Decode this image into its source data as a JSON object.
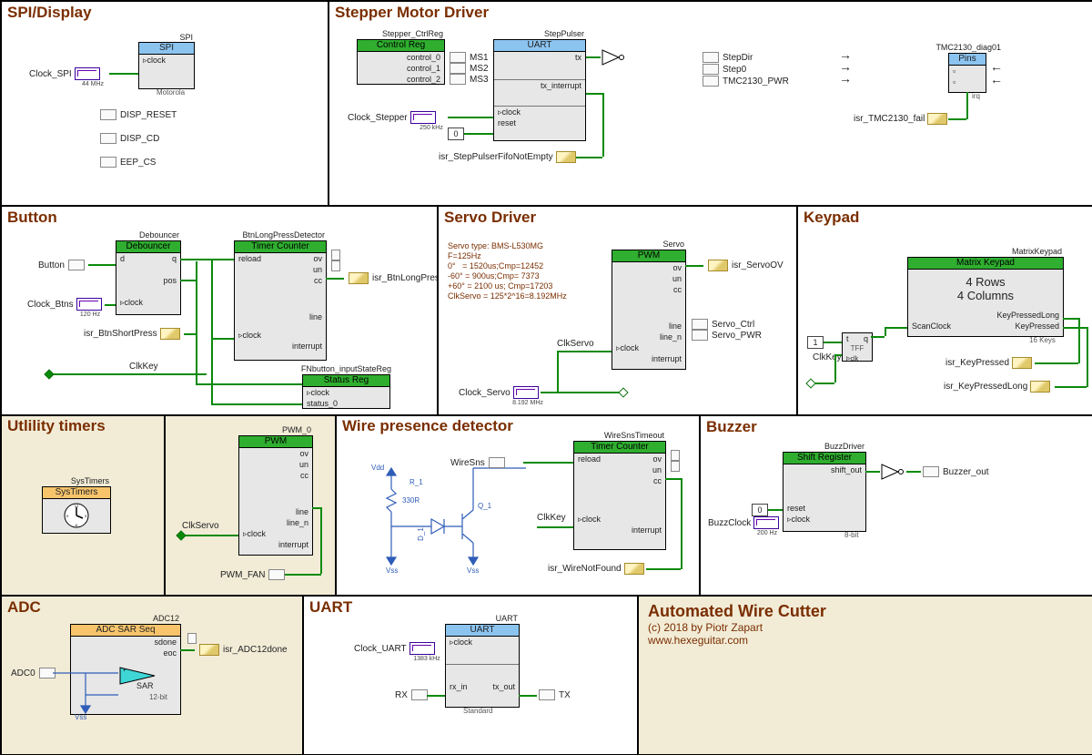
{
  "panels": {
    "spi": "SPI/Display",
    "stepper": "Stepper Motor Driver",
    "button": "Button",
    "servo": "Servo Driver",
    "keypad": "Keypad",
    "util": "Utlility timers",
    "wpd": "Wire presence detector",
    "buzzer": "Buzzer",
    "adc": "ADC",
    "uart": "UART"
  },
  "spi": {
    "comp": "SPI",
    "inst": "SPI",
    "clk": "Clock_SPI",
    "clkrate": "44 MHz",
    "clock": "clock",
    "vendor": "Motorola",
    "p1": "DISP_RESET",
    "p2": "DISP_CD",
    "p3": "EEP_CS"
  },
  "stepper": {
    "ctrlreg": "Control Reg",
    "ctrlinst": "Stepper_CtrlReg",
    "c0": "control_0",
    "c1": "control_1",
    "c2": "control_2",
    "ms1": "MS1",
    "ms2": "MS2",
    "ms3": "MS3",
    "uart": "UART",
    "uartinst": "StepPulser",
    "tx": "tx",
    "txint": "tx_interrupt",
    "clock": "clock",
    "reset": "reset",
    "clk": "Clock_Stepper",
    "clkrate": "250 kHz",
    "zero": "0",
    "isr": "isr_StepPulserFifoNotEmpty",
    "stepdir": "StepDir",
    "step0": "Step0",
    "tmcpwr": "TMC2130_PWR",
    "pins": "Pins",
    "pinsinst": "TMC2130_diag01",
    "irq": "irq",
    "isr2": "isr_TMC2130_fail"
  },
  "button": {
    "btn": "Button",
    "deb": "Debouncer",
    "debinst": "Debouncer",
    "d": "d",
    "q": "q",
    "pos": "pos",
    "clock": "clock",
    "clkbtn": "Clock_Btns",
    "clkrate": "120 Hz",
    "isr1": "isr_BtnShortPress",
    "tc": "Timer Counter",
    "tcinst": "BtnLongPressDetector",
    "reload": "reload",
    "ov": "ov",
    "un": "un",
    "cc": "cc",
    "line": "line",
    "interrupt": "interrupt",
    "isr2": "isr_BtnLongPress",
    "sr": "Status Reg",
    "srinst": "FNbutton_inputStateReg",
    "st0": "status_0",
    "clkkey": "ClkKey"
  },
  "servo": {
    "txt": "Servo type: BMS-L530MG\nF=125Hz\n0°   = 1520us;Cmp=12452\n-60° = 900us;Cmp= 7373\n+60° = 2100 us; Cmp=17203\nClkServo = 125*2^16=8.192MHz",
    "pwm": "PWM",
    "inst": "Servo",
    "ov": "ov",
    "un": "un",
    "cc": "cc",
    "line": "line",
    "linen": "line_n",
    "clock": "clock",
    "interrupt": "interrupt",
    "isr": "isr_ServoOV",
    "ctrl": "Servo_Ctrl",
    "pwr": "Servo_PWR",
    "clksrv": "ClkServo",
    "clk": "Clock_Servo",
    "clkrate": "8.192 MHz"
  },
  "keypad": {
    "mk": "Matrix Keypad",
    "inst": "MatrixKeypad",
    "rows": "4 Rows",
    "cols": "4 Columns",
    "k1": "KeyPressedLong",
    "k2": "KeyPressed",
    "scan": "ScanClock",
    "keys": "16 Keys",
    "isr1": "isr_KeyPressed",
    "isr2": "isr_KeyPressedLong",
    "clkkey": "ClkKey",
    "one": "1",
    "t": "t",
    "q": "q",
    "tff": "TFF",
    "clk": "clk"
  },
  "util": {
    "sys": "SysTimers",
    "inst": "SysTimers"
  },
  "pwm0": {
    "pwm": "PWM",
    "inst": "PWM_0",
    "ov": "ov",
    "un": "un",
    "cc": "cc",
    "line": "line",
    "linen": "line_n",
    "clock": "clock",
    "interrupt": "interrupt",
    "clksrv": "ClkServo",
    "fan": "PWM_FAN"
  },
  "wpd": {
    "r": "R_1",
    "rval": "330R",
    "d": "D_1",
    "q": "Q_1",
    "wiresns": "WireSns",
    "vdd": "Vdd",
    "vss": "Vss",
    "tc": "Timer Counter",
    "inst": "WireSnsTimeout",
    "reload": "reload",
    "ov": "ov",
    "un": "un",
    "cc": "cc",
    "clock": "clock",
    "interrupt": "interrupt",
    "clkkey": "ClkKey",
    "isr": "isr_WireNotFound"
  },
  "buzzer": {
    "sr": "Shift Register",
    "inst": "BuzzDriver",
    "shift": "shift_out",
    "reset": "reset",
    "clock": "clock",
    "bits": "8-bit",
    "buzz": "Buzzer_out",
    "clk": "BuzzClock",
    "clkrate": "200 Hz",
    "zero": "0"
  },
  "adc": {
    "hdr": "ADC SAR Seq",
    "inst": "ADC12",
    "sdone": "sdone",
    "eoc": "eoc",
    "isr": "isr_ADC12done",
    "sar": "SAR",
    "bits": "12-bit",
    "adc0": "ADC0",
    "vss": "Vss"
  },
  "uart": {
    "hdr": "UART",
    "inst": "UART",
    "clock": "clock",
    "rxin": "rx_in",
    "txout": "tx_out",
    "std": "Standard",
    "clk": "Clock_UART",
    "clkrate": "1383 kHz",
    "rx": "RX",
    "tx": "TX"
  },
  "info": {
    "title": "Automated Wire Cutter",
    "copy": "(c) 2018 by Piotr Zapart",
    "url": "www.hexeguitar.com"
  }
}
